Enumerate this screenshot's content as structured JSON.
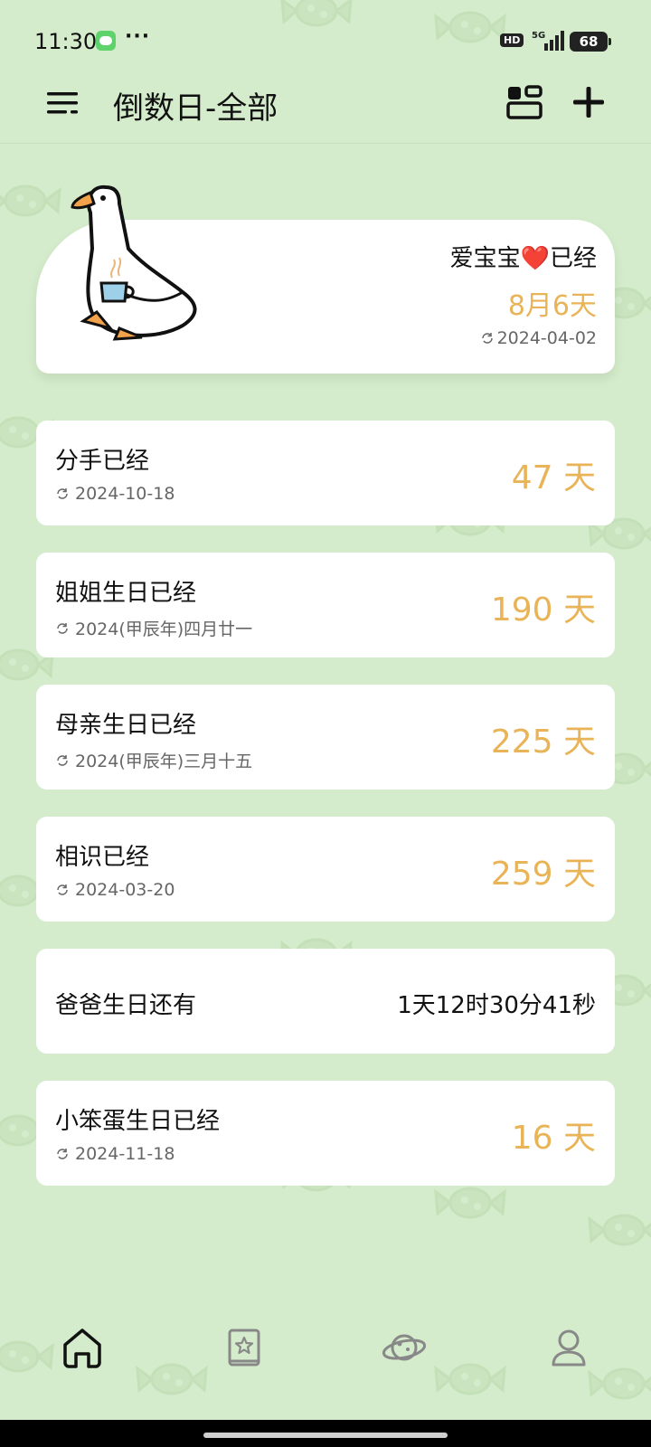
{
  "status_bar": {
    "time": "11:30",
    "dots": "···",
    "hd": "HD",
    "network": "5G",
    "battery": "68"
  },
  "header": {
    "title": "倒数日-全部",
    "icons": [
      "menu-icon",
      "layout-icon",
      "add-icon"
    ]
  },
  "featured": {
    "title": "爱宝宝❤️已经",
    "days": "8月6天",
    "date": "2024-04-02",
    "illustration": "goose-with-cup"
  },
  "events": [
    {
      "title": "分手已经",
      "date": "2024-10-18",
      "days": "47 天"
    },
    {
      "title": "姐姐生日已经",
      "date": "2024(甲辰年)四月廿一",
      "days": "190 天"
    },
    {
      "title": "母亲生日已经",
      "date": "2024(甲辰年)三月十五",
      "days": "225 天"
    },
    {
      "title": "相识已经",
      "date": "2024-03-20",
      "days": "259 天"
    },
    {
      "title": "爸爸生日还有",
      "countdown": "1天12时30分41秒"
    },
    {
      "title": "小笨蛋生日已经",
      "date": "2024-11-18",
      "days": "16 天"
    }
  ],
  "nav": [
    "home-icon",
    "book-star-icon",
    "planet-icon",
    "profile-icon"
  ],
  "colors": {
    "background": "#d4eccb",
    "accent": "#e9b457",
    "card": "#ffffff",
    "text": "#111111"
  }
}
